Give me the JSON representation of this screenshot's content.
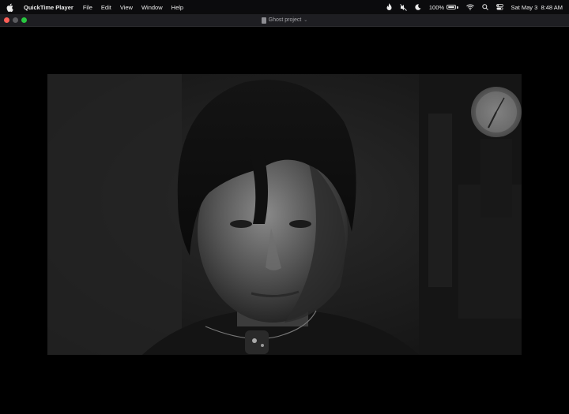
{
  "menubar": {
    "apple_icon": "apple-logo-icon",
    "app_name": "QuickTime Player",
    "menus": [
      "File",
      "Edit",
      "View",
      "Window",
      "Help"
    ],
    "status": {
      "icons": [
        "flame-icon",
        "mute-icon",
        "moon-icon"
      ],
      "battery_percent": "100%",
      "battery_level": 1.0,
      "wifi_icon": "wifi-icon",
      "search_icon": "search-icon",
      "control_center_icon": "control-center-icon",
      "datetime": "Sat May 3  8:48 AM"
    }
  },
  "window": {
    "title": "Ghost project",
    "title_icon": "document-icon",
    "chevron_icon": "chevron-down-icon",
    "controls": [
      "close",
      "minimize",
      "zoom"
    ]
  },
  "colors": {
    "close": "#ff5f57",
    "minimize_inactive": "#5a5a5e",
    "zoom": "#28c840",
    "menubar_bg": "#0b0b0d",
    "titlebar_bg": "#1e1e22"
  }
}
